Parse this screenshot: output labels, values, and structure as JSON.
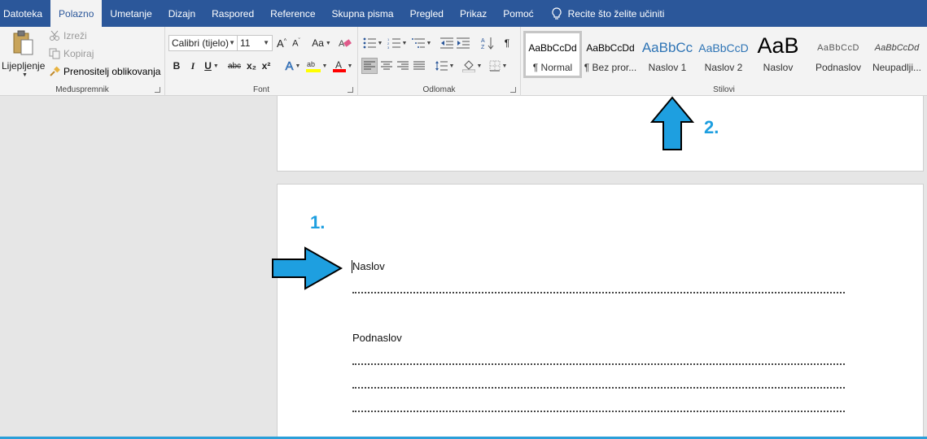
{
  "menu": {
    "tabs": [
      {
        "label": "Datoteka"
      },
      {
        "label": "Polazno"
      },
      {
        "label": "Umetanje"
      },
      {
        "label": "Dizajn"
      },
      {
        "label": "Raspored"
      },
      {
        "label": "Reference"
      },
      {
        "label": "Skupna pisma"
      },
      {
        "label": "Pregled"
      },
      {
        "label": "Prikaz"
      },
      {
        "label": "Pomoć"
      }
    ],
    "tell_me": "Recite što želite učiniti",
    "active_tab": "Polazno"
  },
  "clipboard": {
    "paste_label": "Lijepljenje",
    "cut_label": "Izreži",
    "copy_label": "Kopiraj",
    "format_painter_label": "Prenositelj oblikovanja",
    "group_label": "Međuspremnik"
  },
  "font": {
    "font_name": "Calibri (tijelo)",
    "font_size": "11",
    "change_case": "Aa",
    "group_label": "Font",
    "bold": "B",
    "italic": "I",
    "underline": "U",
    "strike": "abc",
    "subscript": "x₂",
    "superscript": "x²"
  },
  "paragraph": {
    "group_label": "Odlomak",
    "pilcrow": "¶"
  },
  "styles": {
    "group_label": "Stilovi",
    "items": [
      {
        "preview": "AaBbCcDd",
        "name": "¶ Normal"
      },
      {
        "preview": "AaBbCcDd",
        "name": "¶ Bez pror..."
      },
      {
        "preview": "AaBbCc",
        "name": "Naslov 1"
      },
      {
        "preview": "AaBbCcD",
        "name": "Naslov 2"
      },
      {
        "preview": "AaB",
        "name": "Naslov"
      },
      {
        "preview": "AaBbCcD",
        "name": "Podnaslov"
      },
      {
        "preview": "AaBbCcDd",
        "name": "Neupadlji..."
      }
    ]
  },
  "document": {
    "heading_text": "Naslov",
    "subheading_text": "Podnaslov"
  },
  "annotations": {
    "step1": "1.",
    "step2": "2."
  },
  "colors": {
    "menubar": "#2b579a",
    "accent_arrow": "#1e9fe0",
    "highlight_yellow": "#ffff00",
    "font_red": "#ff0000"
  }
}
